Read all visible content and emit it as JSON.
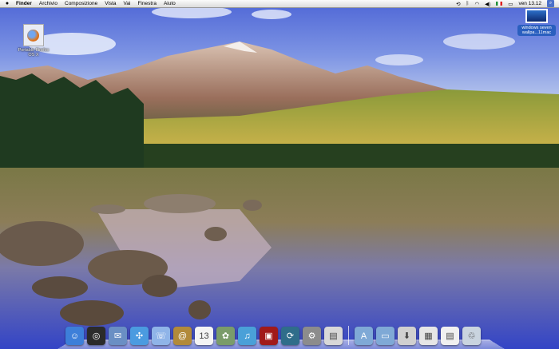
{
  "menubar": {
    "apple_icon": "apple-icon",
    "items": [
      {
        "label": "Finder",
        "bold": true
      },
      {
        "label": "Archivio"
      },
      {
        "label": "Composizione"
      },
      {
        "label": "Vista"
      },
      {
        "label": "Vai"
      },
      {
        "label": "Finestra"
      },
      {
        "label": "Aiuto"
      }
    ],
    "status": {
      "clock": "ven 13.12"
    }
  },
  "desktop_icons": [
    {
      "label": "Portable Firefox OS X",
      "icon": "firefox-app-icon"
    },
    {
      "label": "windows seven wallpa...11mac",
      "icon": "image-file-icon"
    }
  ],
  "dock": {
    "apps": [
      {
        "icon": "finder-icon",
        "glyph": "☺",
        "color": "#3d7fd9"
      },
      {
        "icon": "dashboard-icon",
        "glyph": "◎",
        "color": "#2b2b2b"
      },
      {
        "icon": "mail-icon",
        "glyph": "✉",
        "color": "#6a8fc4"
      },
      {
        "icon": "safari-icon",
        "glyph": "✣",
        "color": "#4b9be0"
      },
      {
        "icon": "ichat-icon",
        "glyph": "☏",
        "color": "#8fb4e8"
      },
      {
        "icon": "address-book-icon",
        "glyph": "@",
        "color": "#b28a3a"
      },
      {
        "icon": "ical-icon",
        "glyph": "13",
        "color": "#f4f4f4"
      },
      {
        "icon": "iphoto-icon",
        "glyph": "✿",
        "color": "#7a9c6a"
      },
      {
        "icon": "itunes-icon",
        "glyph": "♫",
        "color": "#4aa0d8"
      },
      {
        "icon": "front-row-icon",
        "glyph": "▣",
        "color": "#a11a1a"
      },
      {
        "icon": "time-machine-icon",
        "glyph": "⟳",
        "color": "#2f6d8a"
      },
      {
        "icon": "system-preferences-icon",
        "glyph": "⚙",
        "color": "#8c8c8c"
      },
      {
        "icon": "preview-icon",
        "glyph": "▤",
        "color": "#d8d8d8"
      }
    ],
    "stacks": [
      {
        "icon": "applications-folder-icon",
        "glyph": "A",
        "color": "#7fa9d6"
      },
      {
        "icon": "documents-folder-icon",
        "glyph": "▭",
        "color": "#7fa9d6"
      },
      {
        "icon": "downloads-stack-icon",
        "glyph": "⬇",
        "color": "#d0d0d0"
      },
      {
        "icon": "screenshots-stack-icon",
        "glyph": "▦",
        "color": "#e6e6e6"
      },
      {
        "icon": "documents-stack-icon",
        "glyph": "▤",
        "color": "#f0f0f0"
      },
      {
        "icon": "trash-icon",
        "glyph": "♲",
        "color": "#c9d4df"
      }
    ]
  }
}
